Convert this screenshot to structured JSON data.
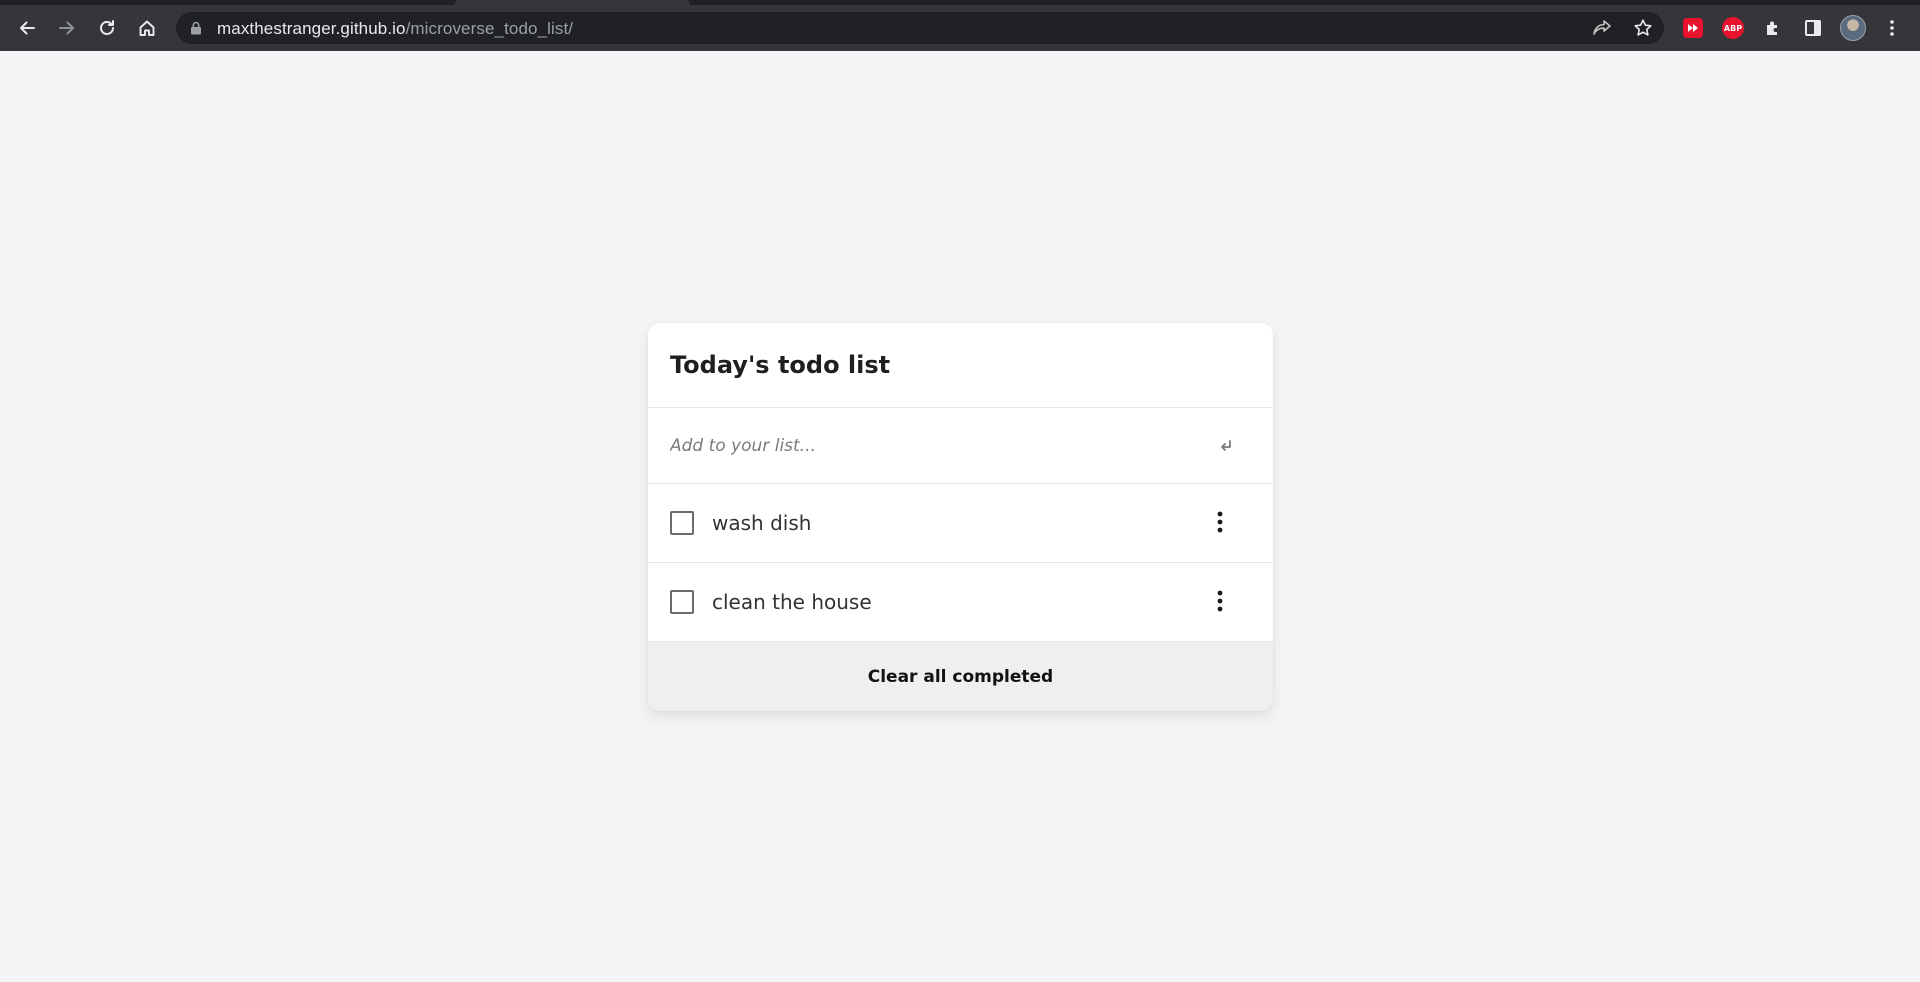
{
  "browser": {
    "url_host": "maxthestranger.github.io",
    "url_path": "/microverse_todo_list/",
    "extensions": {
      "abp_label": "ABP"
    }
  },
  "todo": {
    "title": "Today's todo list",
    "input_placeholder": "Add to your list...",
    "items": [
      {
        "label": "wash dish",
        "completed": false
      },
      {
        "label": "clean the house",
        "completed": false
      }
    ],
    "clear_label": "Clear all completed"
  },
  "colors": {
    "page_background": "#f3f4f6",
    "chrome_background": "#35363a",
    "card_background": "#ffffff",
    "footer_background": "#efefef",
    "extension_red": "#e8142d"
  },
  "icons": {
    "back": "arrow-left-icon",
    "forward": "arrow-right-icon",
    "reload": "reload-icon",
    "home": "home-icon",
    "lock": "lock-icon",
    "share": "share-icon",
    "bookmark": "star-icon",
    "extensions": "puzzle-icon",
    "side_panel": "side-panel-icon",
    "menu": "kebab-menu-icon",
    "enter": "enter-icon",
    "item_menu": "vertical-dots-icon"
  }
}
